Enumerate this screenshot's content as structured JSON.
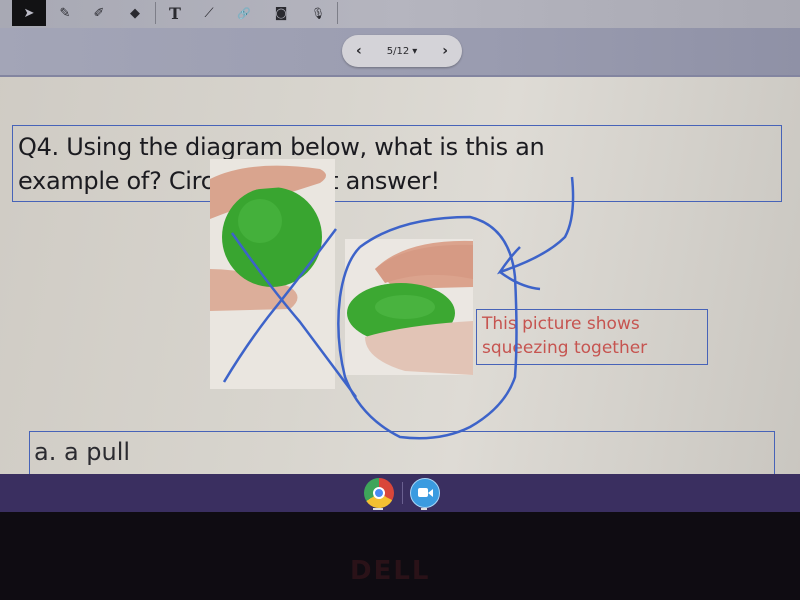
{
  "toolbar": {
    "tools": [
      {
        "name": "select",
        "icon": "cursor-icon",
        "glyph": "➤",
        "active": true
      },
      {
        "name": "pen",
        "icon": "pen-icon",
        "glyph": "✎",
        "active": false
      },
      {
        "name": "highlighter",
        "icon": "highlighter-icon",
        "glyph": "✐",
        "active": false
      },
      {
        "name": "eraser",
        "icon": "eraser-icon",
        "glyph": "◆",
        "active": false
      },
      {
        "name": "text",
        "icon": "text-icon",
        "glyph": "T",
        "active": false
      },
      {
        "name": "line",
        "icon": "line-icon",
        "glyph": "⟋",
        "active": false
      },
      {
        "name": "link",
        "icon": "link-icon",
        "glyph": "🔗",
        "active": false
      },
      {
        "name": "camera",
        "icon": "camera-icon",
        "glyph": "◙",
        "active": false
      },
      {
        "name": "microphone",
        "icon": "microphone-icon",
        "glyph": "🎙",
        "active": false
      }
    ]
  },
  "pager": {
    "prev_glyph": "‹",
    "page_label": "5/12",
    "dropdown_glyph": "▾",
    "next_glyph": "›"
  },
  "slide": {
    "question_line1": "Q4. Using the diagram below, what is this an",
    "question_line2": "example of? Circle the best answer!",
    "note_line1": "This picture shows",
    "note_line2": "squeezing together",
    "answer_a": "a. a pull"
  },
  "shelf": {
    "apps": [
      {
        "name": "Chrome",
        "icon": "chrome-icon"
      },
      {
        "name": "Zoom",
        "icon": "zoom-icon"
      }
    ]
  },
  "bezel": {
    "logo": "DELL"
  },
  "colors": {
    "ink": "#3d63c9",
    "note_text": "#c65450",
    "box_border": "#4763b8",
    "shelf": "#3a2f60"
  }
}
